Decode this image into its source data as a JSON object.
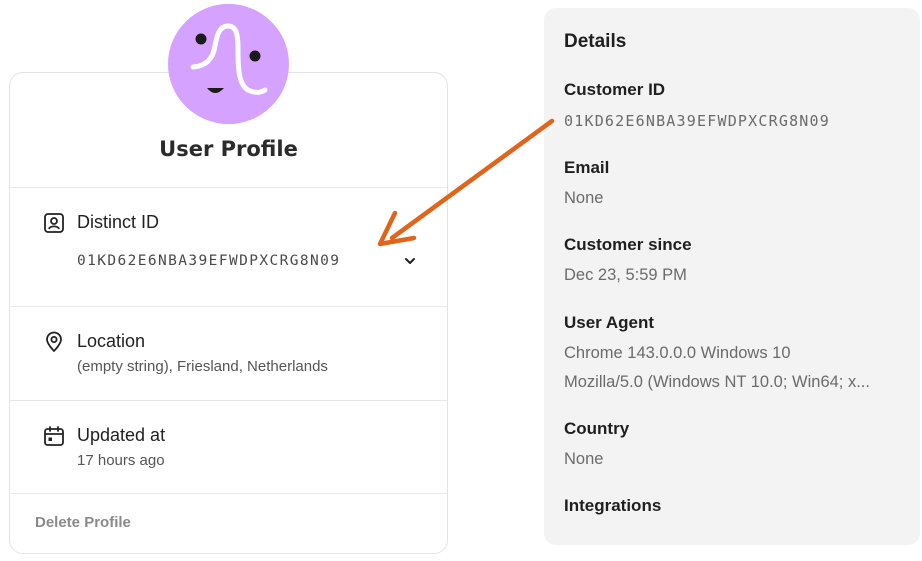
{
  "profile": {
    "title": "User Profile",
    "distinct_id": {
      "label": "Distinct ID",
      "value": "01KD62E6NBA39EFWDPXCRG8N09"
    },
    "location": {
      "label": "Location",
      "value": "(empty string), Friesland, Netherlands"
    },
    "updated_at": {
      "label": "Updated at",
      "value": "17 hours ago"
    },
    "delete_label": "Delete Profile"
  },
  "details": {
    "title": "Details",
    "fields": [
      {
        "label": "Customer ID",
        "value": "01KD62E6NBA39EFWDPXCRG8N09"
      },
      {
        "label": "Email",
        "value": "None"
      },
      {
        "label": "Customer since",
        "value": "Dec 23, 5:59 PM"
      },
      {
        "label": "User Agent",
        "value": "Chrome 143.0.0.0 Windows 10",
        "value2": "Mozilla/5.0 (Windows NT 10.0; Win64; x..."
      },
      {
        "label": "Country",
        "value": "None"
      },
      {
        "label": "Integrations"
      }
    ]
  },
  "colors": {
    "avatar_bg": "#d5a2ff",
    "arrow": "#e0641a",
    "panel_bg": "#f3f3f3"
  },
  "icons": {
    "distinct_id": "id-badge-icon",
    "location": "map-pin-icon",
    "updated_at": "calendar-icon",
    "expand": "chevron-down-icon"
  }
}
